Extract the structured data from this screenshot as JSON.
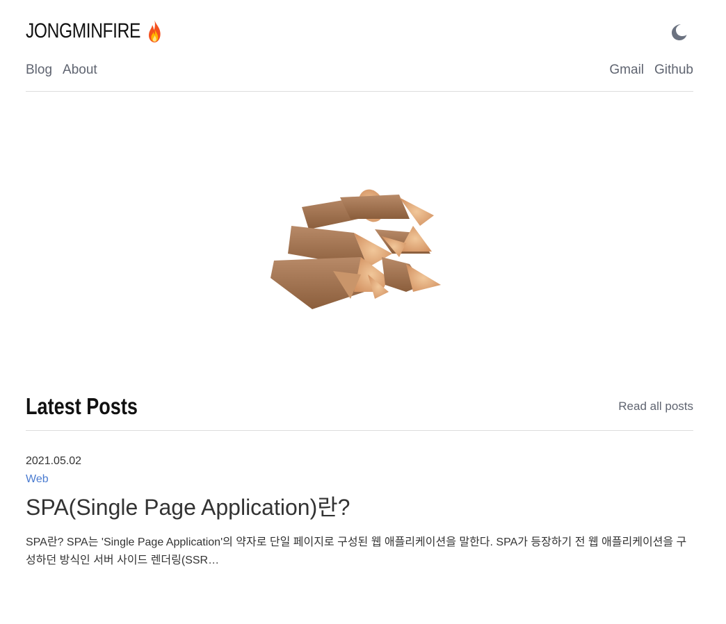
{
  "header": {
    "site_title": "JONGMINFIRE",
    "title_icon": "fire-emoji",
    "theme_toggle_icon": "moon-icon"
  },
  "nav": {
    "left": [
      {
        "label": "Blog"
      },
      {
        "label": "About"
      }
    ],
    "right": [
      {
        "label": "Gmail"
      },
      {
        "label": "Github"
      }
    ]
  },
  "hero": {
    "image": "firewood-stack"
  },
  "latest": {
    "title": "Latest Posts",
    "read_all": "Read all posts"
  },
  "posts": [
    {
      "date": "2021.05.02",
      "category": "Web",
      "title": "SPA(Single Page Application)란?",
      "excerpt": "SPA란? SPA는 'Single Page Application'의 약자로 단일 페이지로 구성된 웹 애플리케이션을 말한다. SPA가 등장하기 전 웹 애플리케이션을 구성하던 방식인 서버 사이드 렌더링(SSR…"
    }
  ],
  "colors": {
    "nav_text": "#5f6470",
    "category": "#4a7bd0",
    "divider": "#dcdcdc"
  }
}
